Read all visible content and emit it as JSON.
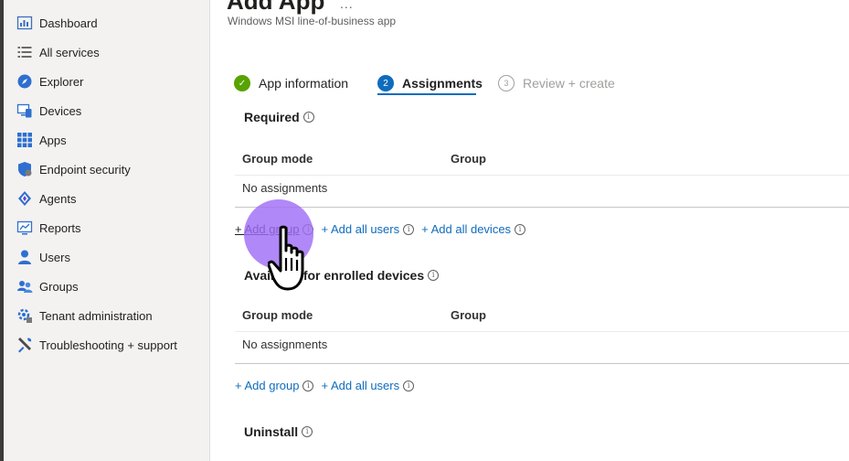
{
  "sidebar": {
    "items": [
      {
        "label": "Dashboard",
        "icon": "dashboard-icon"
      },
      {
        "label": "All services",
        "icon": "list-icon"
      },
      {
        "label": "Explorer",
        "icon": "explorer-icon"
      },
      {
        "label": "Devices",
        "icon": "devices-icon"
      },
      {
        "label": "Apps",
        "icon": "apps-grid-icon"
      },
      {
        "label": "Endpoint security",
        "icon": "shield-icon"
      },
      {
        "label": "Agents",
        "icon": "agents-icon"
      },
      {
        "label": "Reports",
        "icon": "reports-icon"
      },
      {
        "label": "Users",
        "icon": "user-icon"
      },
      {
        "label": "Groups",
        "icon": "groups-icon"
      },
      {
        "label": "Tenant administration",
        "icon": "tenant-admin-icon"
      },
      {
        "label": "Troubleshooting + support",
        "icon": "wrench-icon"
      }
    ]
  },
  "header": {
    "title": "Add App",
    "title_extra": "...",
    "subtitle": "Windows MSI line-of-business app"
  },
  "wizard": {
    "steps": [
      {
        "label": "App information",
        "state": "complete",
        "marker": "✓"
      },
      {
        "label": "Assignments",
        "state": "active",
        "marker": "2"
      },
      {
        "label": "Review + create",
        "state": "pending",
        "marker": "3"
      }
    ]
  },
  "sections": {
    "required": {
      "title": "Required",
      "col_group_mode": "Group mode",
      "col_group": "Group",
      "empty": "No assignments",
      "add_group": "+ Add group",
      "add_all_users": "+ Add all users",
      "add_all_devices": "+ Add all devices"
    },
    "available": {
      "title": "Available for enrolled devices",
      "col_group_mode": "Group mode",
      "col_group": "Group",
      "empty": "No assignments",
      "add_group": "+ Add group",
      "add_all_users": "+ Add all users"
    },
    "uninstall": {
      "title": "Uninstall"
    }
  },
  "colors": {
    "accent": "#0f6cbd",
    "success": "#57a300",
    "cursor_halo": "#a06ef5"
  }
}
